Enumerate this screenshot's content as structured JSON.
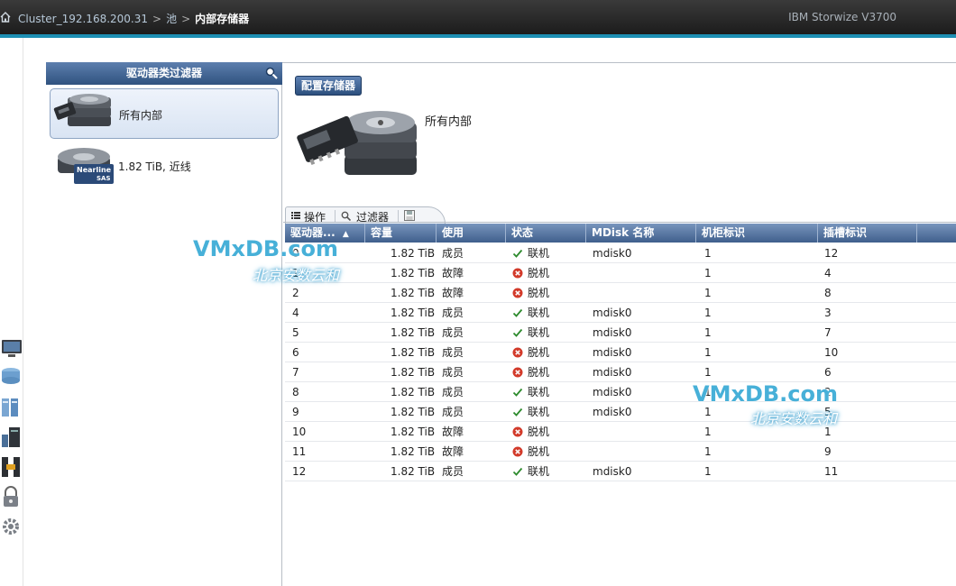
{
  "topbar": {
    "breadcrumbs": [
      {
        "label": "Cluster_192.168.200.31"
      },
      {
        "label": "池"
      },
      {
        "label": "内部存储器"
      }
    ],
    "separator": ">",
    "product": "IBM Storwize V3700"
  },
  "filter_panel": {
    "title": "驱动器类过滤器",
    "items": [
      {
        "label": "所有内部",
        "selected": true
      },
      {
        "label": "1.82 TiB, 近线",
        "badge_top": "Nearline",
        "badge_bottom": "SAS"
      }
    ]
  },
  "content": {
    "config_button": "配置存储器",
    "selected_filter_label": "所有内部",
    "toolbar": {
      "actions": "操作",
      "filter": "过滤器"
    },
    "table": {
      "columns": [
        "驱动器...",
        "容量",
        "使用",
        "状态",
        "MDisk 名称",
        "机柜标识",
        "插槽标识"
      ],
      "sort_indicator": "▲",
      "rows": [
        {
          "id": "0",
          "capacity": "1.82 TiB",
          "use": "成员",
          "status": "联机",
          "status_kind": "online",
          "mdisk": "mdisk0",
          "enclosure": "1",
          "slot": "12"
        },
        {
          "id": "1",
          "capacity": "1.82 TiB",
          "use": "故障",
          "status": "脱机",
          "status_kind": "offline",
          "mdisk": "",
          "enclosure": "1",
          "slot": "4"
        },
        {
          "id": "2",
          "capacity": "1.82 TiB",
          "use": "故障",
          "status": "脱机",
          "status_kind": "offline",
          "mdisk": "",
          "enclosure": "1",
          "slot": "8"
        },
        {
          "id": "4",
          "capacity": "1.82 TiB",
          "use": "成员",
          "status": "联机",
          "status_kind": "online",
          "mdisk": "mdisk0",
          "enclosure": "1",
          "slot": "3"
        },
        {
          "id": "5",
          "capacity": "1.82 TiB",
          "use": "成员",
          "status": "联机",
          "status_kind": "online",
          "mdisk": "mdisk0",
          "enclosure": "1",
          "slot": "7"
        },
        {
          "id": "6",
          "capacity": "1.82 TiB",
          "use": "成员",
          "status": "脱机",
          "status_kind": "offline",
          "mdisk": "mdisk0",
          "enclosure": "1",
          "slot": "10"
        },
        {
          "id": "7",
          "capacity": "1.82 TiB",
          "use": "成员",
          "status": "脱机",
          "status_kind": "offline",
          "mdisk": "mdisk0",
          "enclosure": "1",
          "slot": "6"
        },
        {
          "id": "8",
          "capacity": "1.82 TiB",
          "use": "成员",
          "status": "联机",
          "status_kind": "online",
          "mdisk": "mdisk0",
          "enclosure": "1",
          "slot": "2"
        },
        {
          "id": "9",
          "capacity": "1.82 TiB",
          "use": "成员",
          "status": "联机",
          "status_kind": "online",
          "mdisk": "mdisk0",
          "enclosure": "1",
          "slot": "5"
        },
        {
          "id": "10",
          "capacity": "1.82 TiB",
          "use": "故障",
          "status": "脱机",
          "status_kind": "offline",
          "mdisk": "",
          "enclosure": "1",
          "slot": "1"
        },
        {
          "id": "11",
          "capacity": "1.82 TiB",
          "use": "故障",
          "status": "脱机",
          "status_kind": "offline",
          "mdisk": "",
          "enclosure": "1",
          "slot": "9"
        },
        {
          "id": "12",
          "capacity": "1.82 TiB",
          "use": "成员",
          "status": "联机",
          "status_kind": "online",
          "mdisk": "mdisk0",
          "enclosure": "1",
          "slot": "11"
        }
      ]
    }
  },
  "watermark": {
    "brand": "VMxDB.com",
    "tagline": "北京安数云和"
  },
  "colors": {
    "online": "#2e8b2e",
    "offline": "#d23a2a",
    "header_blue": "#3f5f8c",
    "accent": "#1d8fb3"
  },
  "icons": {
    "home": "home-icon",
    "search": "search-icon",
    "actions": "list-icon",
    "filter": "magnifier-icon",
    "save": "floppy-disk-icon",
    "online": "checkmark-icon",
    "offline": "error-x-icon"
  }
}
